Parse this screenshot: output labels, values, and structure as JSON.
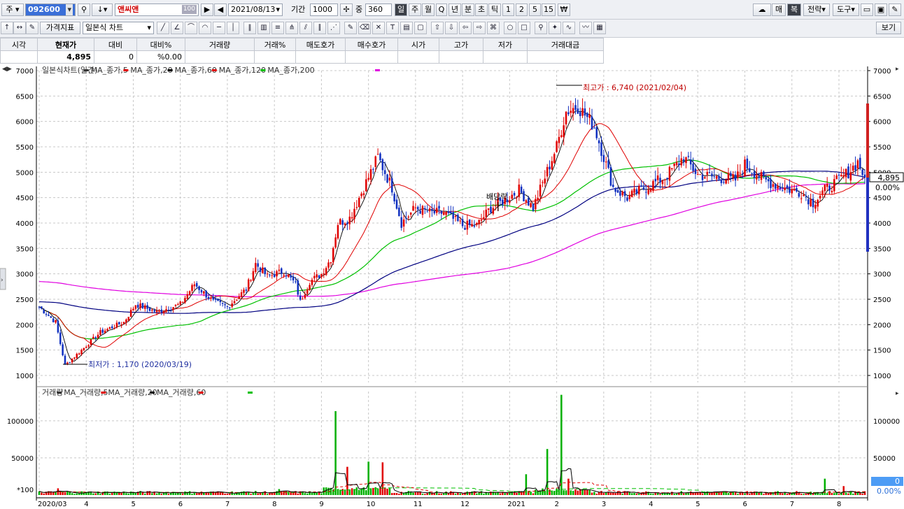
{
  "toolbar": {
    "market_label": "주",
    "code_value": "092600",
    "stock_name": "앤씨앤",
    "name_badge": "100",
    "date_value": "2021/08/13",
    "period_label": "기간",
    "period_value": "1000",
    "zoom_label": "중",
    "zoom_value": "360",
    "interval_buttons": [
      "일",
      "주",
      "월",
      "Q",
      "년",
      "분",
      "초",
      "틱",
      "1",
      "2",
      "5",
      "15",
      "₩"
    ],
    "right_buttons": [
      "매",
      "복",
      "전략",
      "도구"
    ]
  },
  "toolbar2": {
    "indicator_label": "가격지표",
    "chart_type": "일본식 차트",
    "view_button": "보기"
  },
  "quote": {
    "headers": [
      "시각",
      "현재가",
      "대비",
      "대비%",
      "거래량",
      "거래%",
      "매도호가",
      "매수호가",
      "시가",
      "고가",
      "저가",
      "거래대금"
    ],
    "values": [
      "",
      "4,895",
      "0",
      "%0.00",
      "",
      "",
      "",
      "",
      "",
      "",
      "",
      ""
    ]
  },
  "price_panel": {
    "legend": [
      {
        "text": "일본식차트(일간)",
        "color": "#333333"
      },
      {
        "text": "MA_종가,5",
        "color": "#e00000"
      },
      {
        "text": "MA_종가,20",
        "color": "#000000"
      },
      {
        "text": "MA_종가,60",
        "color": "#e00000"
      },
      {
        "text": "MA_종가,120",
        "color": "#00c000"
      },
      {
        "text": "MA_종가,200",
        "color": "#000080"
      }
    ],
    "high_note": "최고가 : 6,740 (2021/02/04)",
    "low_note": "최저가 : 1,170 (2020/03/19)",
    "event_note": "배당락",
    "current_price": "4,895",
    "current_change": "0.00%"
  },
  "volume_panel": {
    "legend": [
      {
        "text": "거래량",
        "color": "#333333"
      },
      {
        "text": "MA_거래량,5",
        "color": "#e00000"
      },
      {
        "text": "MA_거래량,20",
        "color": "#000000"
      },
      {
        "text": "MA_거래량,60",
        "color": "#e00000"
      }
    ],
    "unit": "*100",
    "current_volume": "0",
    "current_change": "0.00%"
  },
  "chart_data": {
    "type": "candlestick",
    "x_labels": [
      "2020/03",
      "4",
      "5",
      "6",
      "7",
      "8",
      "9",
      "10",
      "11",
      "12",
      "2021",
      "2",
      "3",
      "4",
      "5",
      "6",
      "7",
      "8"
    ],
    "y_ticks": [
      1000,
      1500,
      2000,
      2500,
      3000,
      3500,
      4000,
      4500,
      5000,
      5500,
      6000,
      6500,
      7000
    ],
    "ylim": [
      1000,
      7000
    ],
    "volume_ticks": [
      50000,
      100000
    ],
    "volume_ylim": [
      0,
      130000
    ],
    "close_anchors": [
      {
        "m": 0.0,
        "v": 2350
      },
      {
        "m": 0.35,
        "v": 2050
      },
      {
        "m": 0.55,
        "v": 1200
      },
      {
        "m": 0.9,
        "v": 1500
      },
      {
        "m": 1.3,
        "v": 1850
      },
      {
        "m": 1.8,
        "v": 2050
      },
      {
        "m": 2.05,
        "v": 2400
      },
      {
        "m": 2.5,
        "v": 2250
      },
      {
        "m": 3.0,
        "v": 2400
      },
      {
        "m": 3.3,
        "v": 2800
      },
      {
        "m": 3.7,
        "v": 2450
      },
      {
        "m": 4.0,
        "v": 2350
      },
      {
        "m": 4.4,
        "v": 2700
      },
      {
        "m": 4.6,
        "v": 3200
      },
      {
        "m": 4.85,
        "v": 2950
      },
      {
        "m": 5.2,
        "v": 3050
      },
      {
        "m": 5.45,
        "v": 2800
      },
      {
        "m": 5.55,
        "v": 2450
      },
      {
        "m": 5.75,
        "v": 2850
      },
      {
        "m": 6.0,
        "v": 3000
      },
      {
        "m": 6.2,
        "v": 3300
      },
      {
        "m": 6.35,
        "v": 4000
      },
      {
        "m": 6.6,
        "v": 4100
      },
      {
        "m": 6.9,
        "v": 4700
      },
      {
        "m": 7.2,
        "v": 5300
      },
      {
        "m": 7.5,
        "v": 4700
      },
      {
        "m": 7.7,
        "v": 4000
      },
      {
        "m": 8.0,
        "v": 4300
      },
      {
        "m": 8.3,
        "v": 4200
      },
      {
        "m": 8.6,
        "v": 4200
      },
      {
        "m": 9.0,
        "v": 3950
      },
      {
        "m": 9.3,
        "v": 3950
      },
      {
        "m": 9.6,
        "v": 4300
      },
      {
        "m": 9.9,
        "v": 4450
      },
      {
        "m": 10.2,
        "v": 4650
      },
      {
        "m": 10.5,
        "v": 4300
      },
      {
        "m": 10.75,
        "v": 4900
      },
      {
        "m": 11.0,
        "v": 5500
      },
      {
        "m": 11.2,
        "v": 6200
      },
      {
        "m": 11.45,
        "v": 6300
      },
      {
        "m": 11.8,
        "v": 5900
      },
      {
        "m": 12.2,
        "v": 4700
      },
      {
        "m": 12.5,
        "v": 4500
      },
      {
        "m": 12.9,
        "v": 4700
      },
      {
        "m": 13.3,
        "v": 4900
      },
      {
        "m": 13.7,
        "v": 5300
      },
      {
        "m": 14.0,
        "v": 4950
      },
      {
        "m": 14.4,
        "v": 4900
      },
      {
        "m": 14.8,
        "v": 4850
      },
      {
        "m": 15.0,
        "v": 5150
      },
      {
        "m": 15.4,
        "v": 4850
      },
      {
        "m": 15.8,
        "v": 4700
      },
      {
        "m": 16.2,
        "v": 4600
      },
      {
        "m": 16.45,
        "v": 4400
      },
      {
        "m": 16.7,
        "v": 4650
      },
      {
        "m": 17.0,
        "v": 4850
      },
      {
        "m": 17.2,
        "v": 5000
      },
      {
        "m": 17.4,
        "v": 5200
      },
      {
        "m": 17.55,
        "v": 4895
      }
    ],
    "volume_spikes": [
      {
        "m": 0.4,
        "v": 9000
      },
      {
        "m": 5.1,
        "v": 8000
      },
      {
        "m": 6.3,
        "v": 113000
      },
      {
        "m": 6.55,
        "v": 38000
      },
      {
        "m": 7.0,
        "v": 45000
      },
      {
        "m": 7.3,
        "v": 44000
      },
      {
        "m": 10.35,
        "v": 28000
      },
      {
        "m": 10.8,
        "v": 62000
      },
      {
        "m": 11.1,
        "v": 135000
      },
      {
        "m": 11.25,
        "v": 22000
      },
      {
        "m": 16.7,
        "v": 22000
      },
      {
        "m": 17.1,
        "v": 12000
      }
    ]
  }
}
